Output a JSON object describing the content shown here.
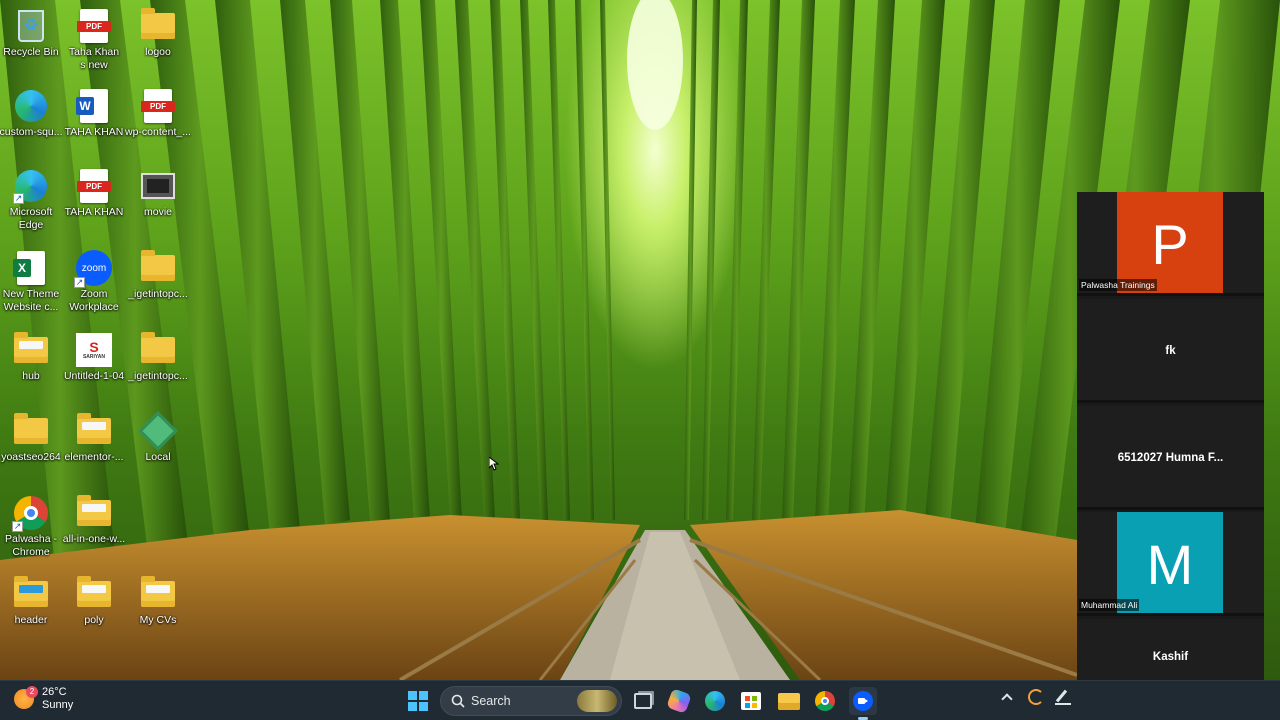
{
  "desktop": {
    "icons": [
      {
        "label": "Recycle Bin",
        "icon": "recycle-bin-icon"
      },
      {
        "label": "Taha Khan\ns new",
        "icon": "pdf-file-icon"
      },
      {
        "label": "logoo",
        "icon": "folder-icon"
      },
      {
        "label": "custom-squ...",
        "icon": "edge-icon"
      },
      {
        "label": "TAHA KHAN",
        "icon": "word-document-icon"
      },
      {
        "label": "wp-content_...",
        "icon": "pdf-file-icon"
      },
      {
        "label": "Microsoft\nEdge",
        "icon": "edge-icon"
      },
      {
        "label": "TAHA KHAN",
        "icon": "pdf-file-icon"
      },
      {
        "label": "movie",
        "icon": "video-file-icon"
      },
      {
        "label": "New Theme\nWebsite c...",
        "icon": "excel-file-icon"
      },
      {
        "label": "Zoom\nWorkplace",
        "icon": "zoom-icon"
      },
      {
        "label": "_igetintopc...",
        "icon": "folder-icon"
      },
      {
        "label": "hub",
        "icon": "folder-icon"
      },
      {
        "label": "Untitled-1-04",
        "icon": "image-file-icon",
        "logo_text": "SARIYAN"
      },
      {
        "label": "_igetintopc...",
        "icon": "folder-icon"
      },
      {
        "label": "yoastseo264",
        "icon": "folder-icon"
      },
      {
        "label": "elementor-...",
        "icon": "folder-icon"
      },
      {
        "label": "Local",
        "icon": "local-app-icon"
      },
      {
        "label": "Palwasha -\nChrome",
        "icon": "chrome-icon"
      },
      {
        "label": "all-in-one-w...",
        "icon": "folder-icon"
      },
      {
        "label": "header",
        "icon": "folder-icon"
      },
      {
        "label": "poly",
        "icon": "folder-icon"
      },
      {
        "label": "My CVs",
        "icon": "folder-icon"
      }
    ]
  },
  "zoom": {
    "participants": [
      {
        "initial": "P",
        "tag": "Palwasha Trainings",
        "color": "#d7410f"
      },
      {
        "name": "fk"
      },
      {
        "name": "6512027 Humna F..."
      },
      {
        "initial": "M",
        "tag": "Muhammad Ali",
        "color": "#0aa0b4"
      },
      {
        "name": "Kashif"
      }
    ]
  },
  "taskbar": {
    "weather": {
      "temp": "26°C",
      "condition": "Sunny",
      "badge": "2"
    },
    "search_label": "Search",
    "pinned": [
      "windows-start-icon",
      "task-view-icon",
      "copilot-icon",
      "edge-icon",
      "store-icon",
      "file-explorer-icon",
      "chrome-icon",
      "zoom-icon"
    ],
    "tray": [
      "chevron-up-icon",
      "sync-icon",
      "pen-icon"
    ]
  },
  "colors": {
    "taskbar_bg": "#1f2a33",
    "zoom_bg": "#1a1a1a",
    "accent": "#0b5cff"
  }
}
